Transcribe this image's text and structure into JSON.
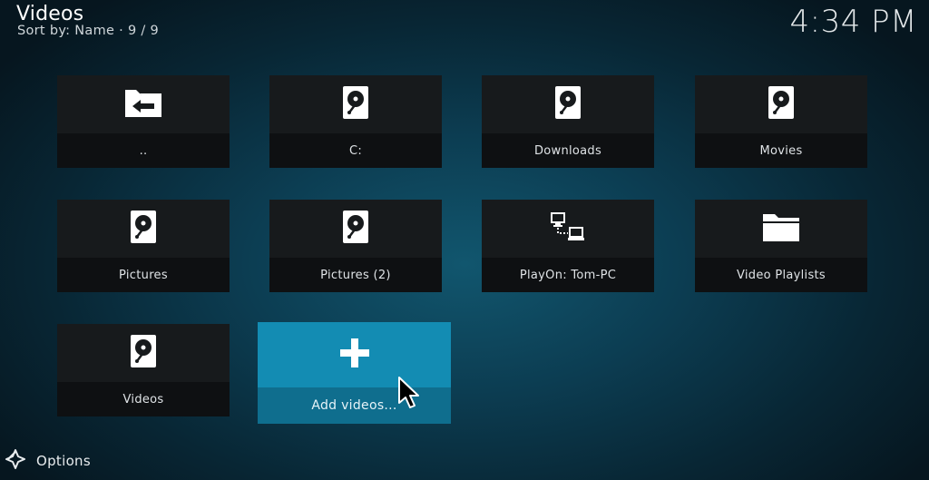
{
  "header": {
    "title": "Videos",
    "sort_info": "Sort by: Name  ·  9 / 9",
    "clock": "4:34 PM"
  },
  "tiles": [
    {
      "label": "..",
      "icon": "folder-back-icon"
    },
    {
      "label": "C:",
      "icon": "hard-drive-icon"
    },
    {
      "label": "Downloads",
      "icon": "hard-drive-icon"
    },
    {
      "label": "Movies",
      "icon": "hard-drive-icon"
    },
    {
      "label": "Pictures",
      "icon": "hard-drive-icon"
    },
    {
      "label": "Pictures (2)",
      "icon": "hard-drive-icon"
    },
    {
      "label": "PlayOn: Tom-PC",
      "icon": "network-icon"
    },
    {
      "label": "Video Playlists",
      "icon": "folder-icon"
    },
    {
      "label": "Videos",
      "icon": "hard-drive-icon"
    },
    {
      "label": "Add videos...",
      "icon": "plus-icon",
      "selected": true
    }
  ],
  "footer": {
    "options_label": "Options",
    "options_icon": "options-icon"
  },
  "colors": {
    "tile_bg": "#171a1c",
    "tile_label_bg": "#0e1012",
    "selected_bg": "#138cb3",
    "selected_label_bg": "#0f6e8e"
  }
}
